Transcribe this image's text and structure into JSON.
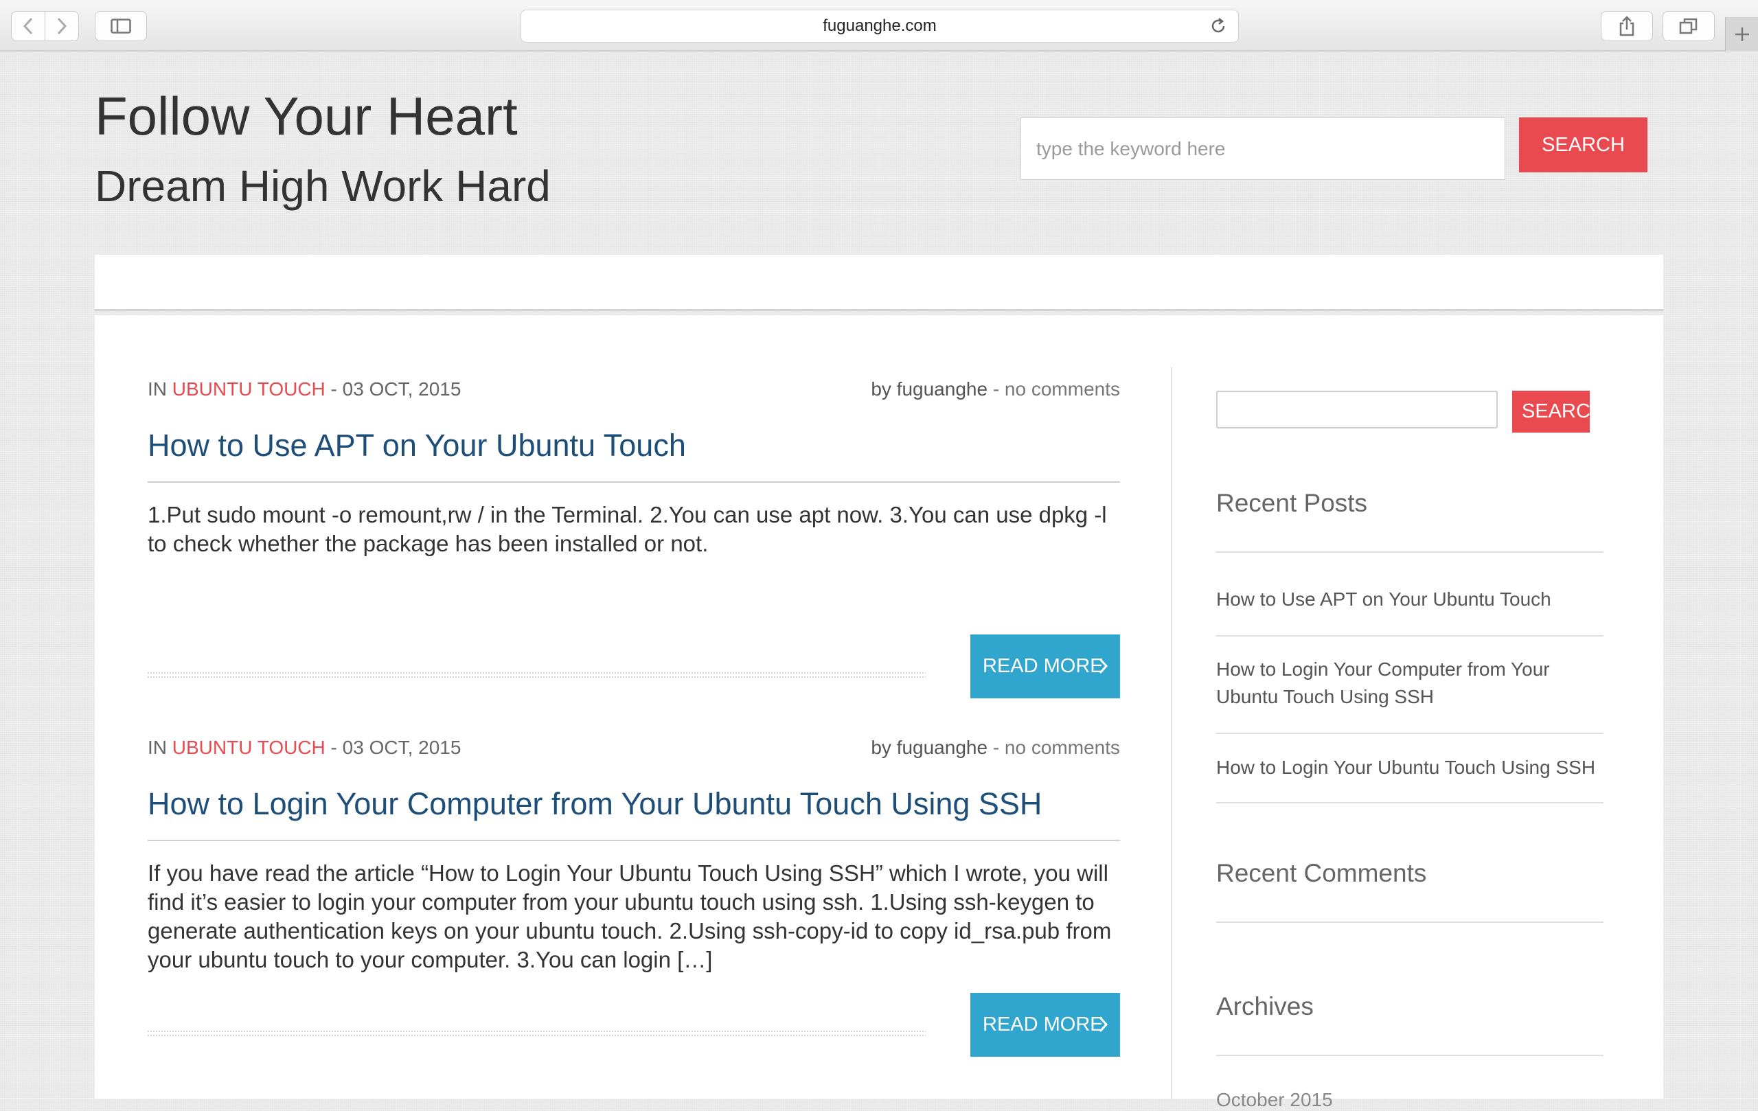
{
  "browser": {
    "url": "fuguanghe.com"
  },
  "header": {
    "title": "Follow Your Heart",
    "tagline": "Dream High Work Hard",
    "search_placeholder": "type the keyword here",
    "search_button": "SEARCH"
  },
  "posts": [
    {
      "category_prefix": "IN",
      "category": "UBUNTU TOUCH",
      "date": "- 03 OCT, 2015",
      "author_prefix": "by",
      "author": "fuguanghe",
      "comments": "- no comments",
      "title": "How to Use APT on Your Ubuntu Touch",
      "excerpt": "1.Put sudo mount -o remount,rw / in the Terminal. 2.You can use apt now. 3.You can use dpkg -l to check whether the package has been installed or not.",
      "read_more": "READ MORE"
    },
    {
      "category_prefix": "IN",
      "category": "UBUNTU TOUCH",
      "date": "- 03 OCT, 2015",
      "author_prefix": "by",
      "author": "fuguanghe",
      "comments": "- no comments",
      "title": "How to Login Your Computer from Your Ubuntu Touch Using SSH",
      "excerpt": "If you have read the article “How to Login Your Ubuntu Touch Using SSH” which I wrote, you will find it’s easier to login your computer from your ubuntu touch using ssh. 1.Using ssh-keygen to generate authentication keys on your ubuntu touch. 2.Using ssh-copy-id to copy id_rsa.pub from your ubuntu touch to your computer. 3.You can login […]",
      "read_more": "READ MORE"
    }
  ],
  "sidebar": {
    "search_button": "SEARCH",
    "recent_posts_title": "Recent Posts",
    "recent_posts": [
      "How to Use APT on Your Ubuntu Touch",
      "How to Login Your Computer from Your Ubuntu Touch Using SSH",
      "How to Login Your Ubuntu Touch Using SSH"
    ],
    "recent_comments_title": "Recent Comments",
    "archives_title": "Archives",
    "archive_partial": "October 2015"
  },
  "colors": {
    "accent_red": "#e94a4f",
    "read_more_blue": "#30a6cf",
    "post_title_blue": "#1d4e79"
  },
  "icons": [
    "back-icon",
    "forward-icon",
    "sidebar-icon",
    "reload-icon",
    "share-icon",
    "tabs-icon",
    "plus-icon",
    "chevron-right-icon"
  ]
}
